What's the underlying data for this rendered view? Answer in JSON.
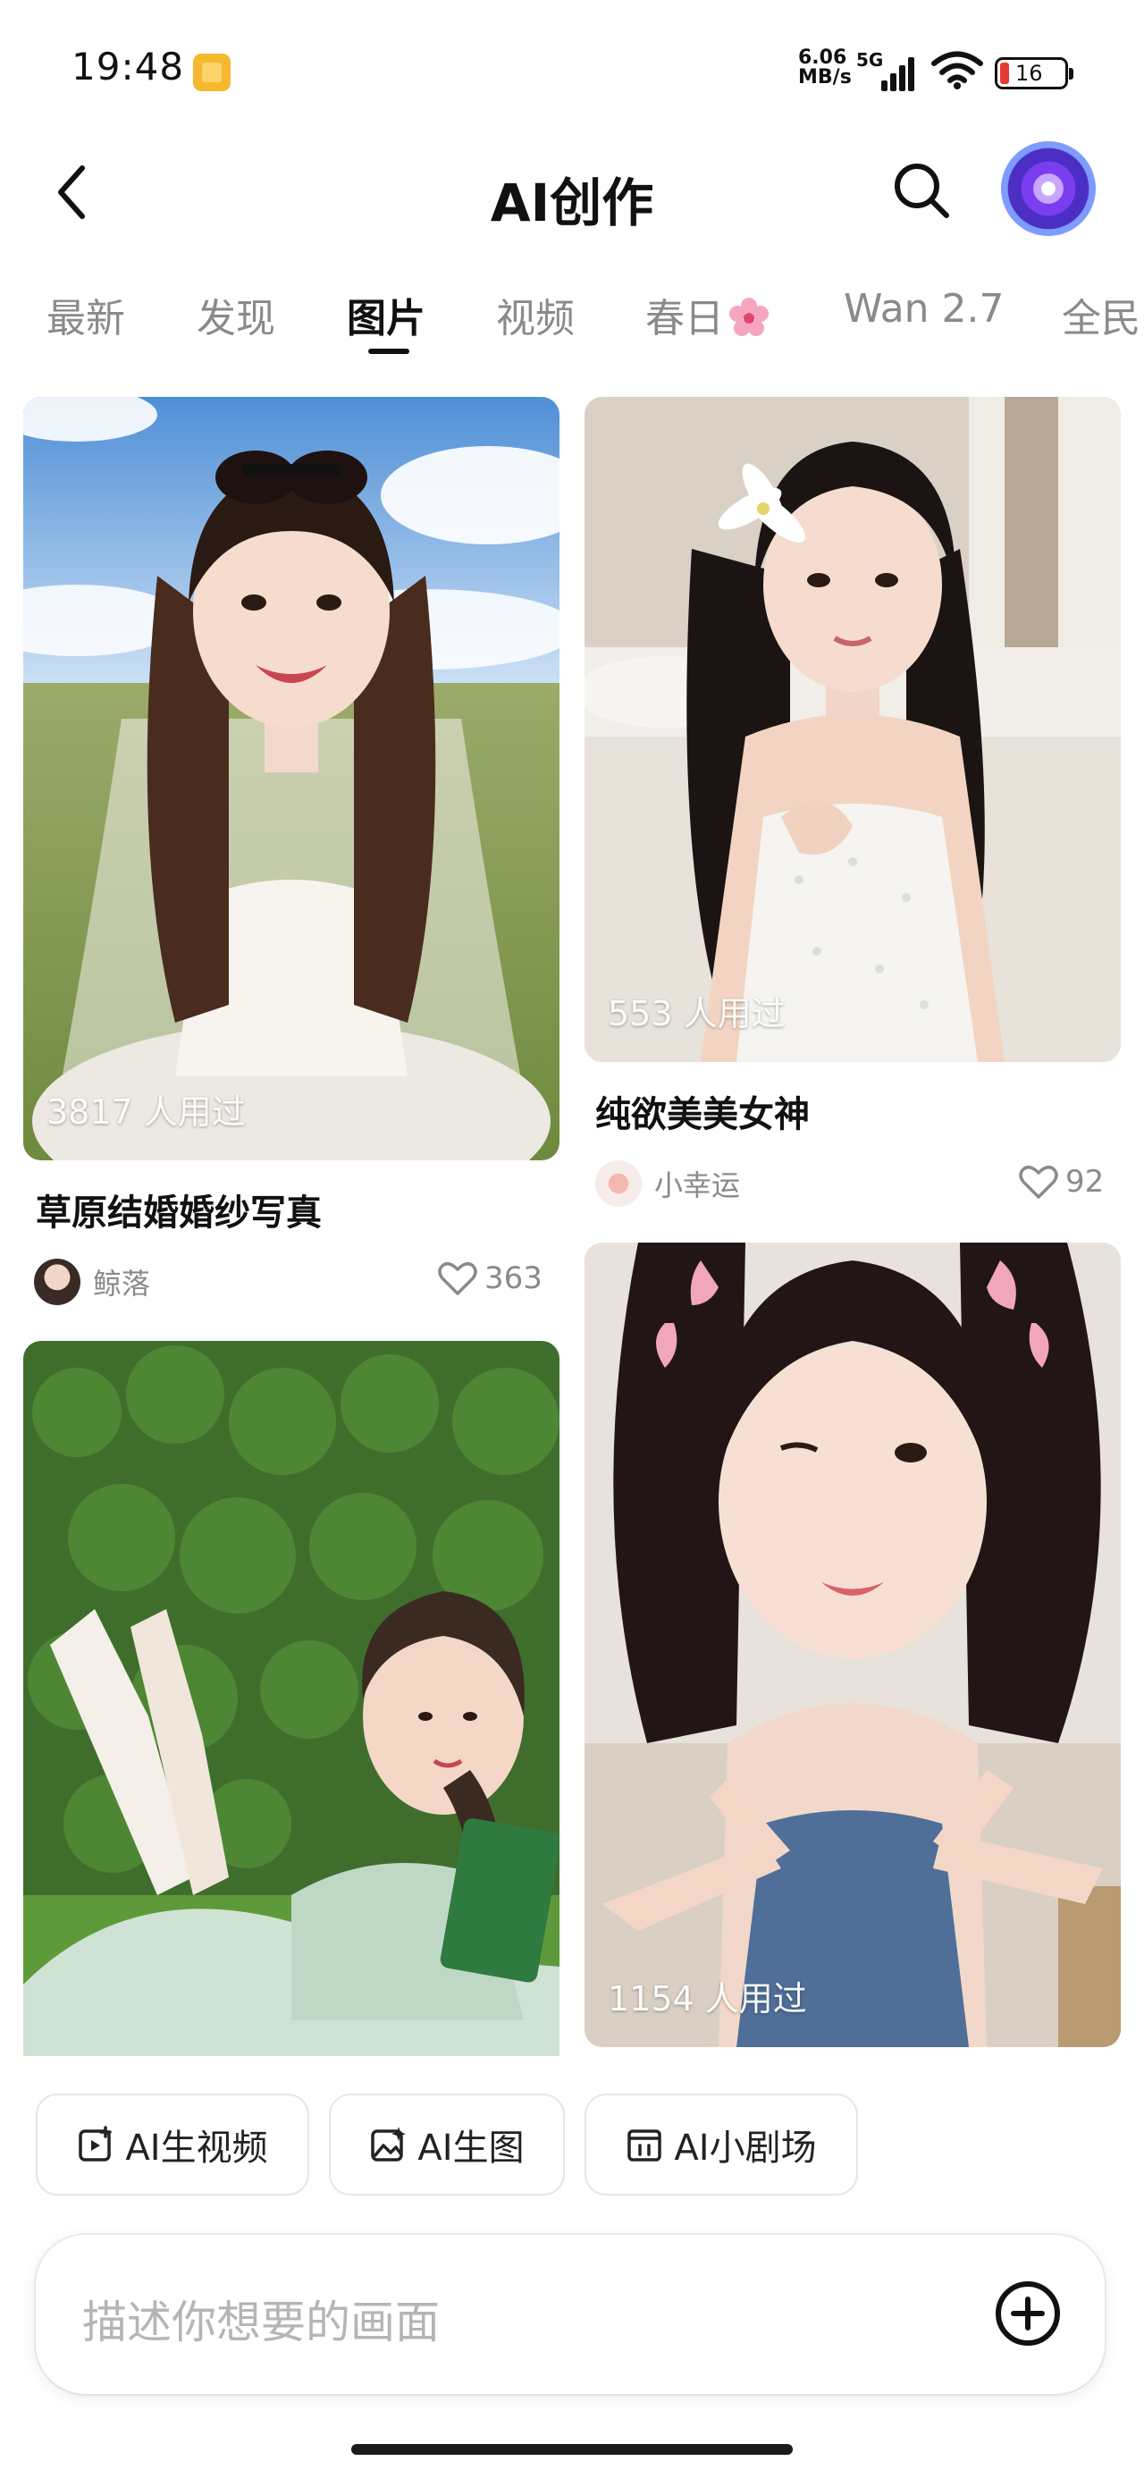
{
  "status_bar": {
    "time": "19:48",
    "net_speed_value": "6.06",
    "net_speed_unit": "MB/s",
    "network": "5G",
    "battery": "16"
  },
  "header": {
    "title": "AI创作"
  },
  "tabs": [
    {
      "label": "最新",
      "active": false
    },
    {
      "label": "发现",
      "active": false
    },
    {
      "label": "图片",
      "active": true
    },
    {
      "label": "视频",
      "active": false
    },
    {
      "label": "春日",
      "active": false
    },
    {
      "label": "Wan 2.7",
      "active": false
    },
    {
      "label": "全民",
      "active": false
    }
  ],
  "feed": {
    "left": [
      {
        "used": "3817 人用过",
        "title": "草原结婚婚纱写真",
        "author": "鲸落",
        "likes": "363"
      },
      {
        "used": "",
        "title": "",
        "author": "",
        "likes": ""
      }
    ],
    "right": [
      {
        "used": "553 人用过",
        "title": "纯欲美美女神",
        "author": "小幸运",
        "likes": "92"
      },
      {
        "used": "1154 人用过",
        "title": "",
        "author": "",
        "likes": ""
      }
    ]
  },
  "actions": [
    {
      "label": "AI生视频",
      "icon": "video-plus-icon"
    },
    {
      "label": "AI生图",
      "icon": "image-sparkle-icon"
    },
    {
      "label": "AI小剧场",
      "icon": "theater-icon"
    }
  ],
  "prompt": {
    "placeholder": "描述你想要的画面"
  },
  "colors": {
    "text_primary": "#111111",
    "text_secondary": "#8a8a8a",
    "battery_low": "#e53935"
  }
}
